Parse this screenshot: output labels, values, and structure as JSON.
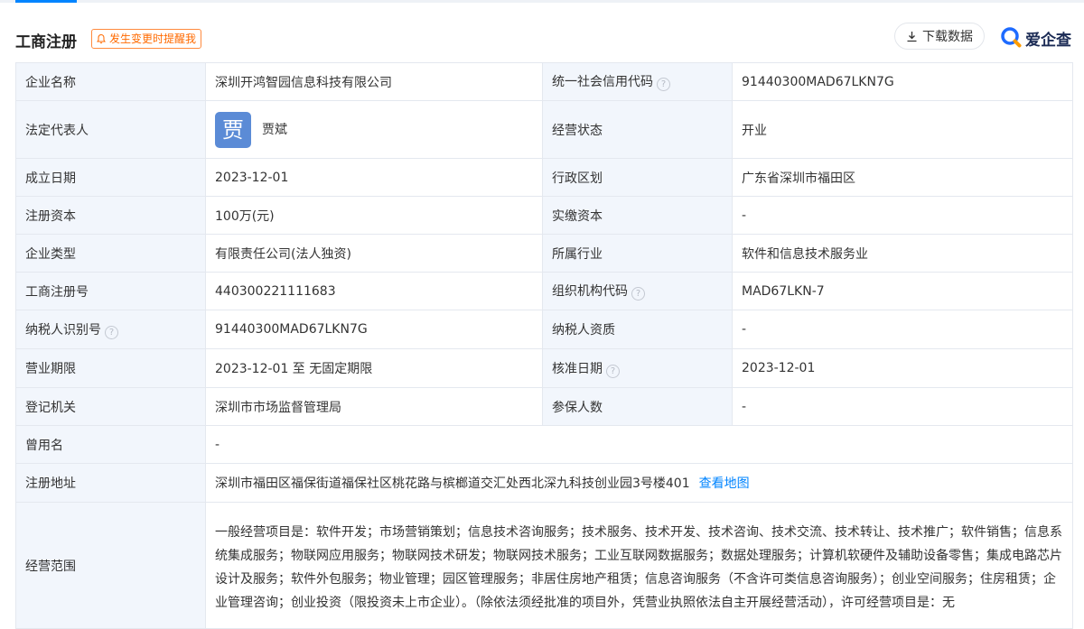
{
  "header": {
    "title": "工商注册",
    "remind_label": "发生变更时提醒我",
    "download_label": "下载数据",
    "brand_label": "爱企查"
  },
  "rows": [
    {
      "l1": "企业名称",
      "v1": "深圳开鸿智园信息科技有限公司",
      "l2": "统一社会信用代码",
      "v2": "91440300MAD67LKN7G"
    },
    {
      "l1": "法定代表人",
      "v1": "贾斌",
      "avatar": "贾",
      "l2": "经营状态",
      "v2": "开业"
    },
    {
      "l1": "成立日期",
      "v1": "2023-12-01",
      "l2": "行政区划",
      "v2": "广东省深圳市福田区"
    },
    {
      "l1": "注册资本",
      "v1": "100万(元)",
      "l2": "实缴资本",
      "v2": "-"
    },
    {
      "l1": "企业类型",
      "v1": "有限责任公司(法人独资)",
      "l2": "所属行业",
      "v2": "软件和信息技术服务业"
    },
    {
      "l1": "工商注册号",
      "v1": "440300221111683",
      "l2": "组织机构代码",
      "v2": "MAD67LKN-7"
    },
    {
      "l1": "纳税人识别号",
      "v1": "91440300MAD67LKN7G",
      "l2": "纳税人资质",
      "v2": "-"
    },
    {
      "l1": "营业期限",
      "v1": "2023-12-01 至 无固定期限",
      "l2": "核准日期",
      "v2": "2023-12-01"
    },
    {
      "l1": "登记机关",
      "v1": "深圳市市场监督管理局",
      "l2": "参保人数",
      "v2": "-"
    },
    {
      "l1": "曾用名",
      "v1": "-"
    },
    {
      "l1": "注册地址",
      "v1": "深圳市福田区福保街道福保社区桃花路与槟榔道交汇处西北深九科技创业园3号楼401",
      "link": "查看地图"
    },
    {
      "l1": "经营范围",
      "v1": "一般经营项目是：软件开发；市场营销策划；信息技术咨询服务；技术服务、技术开发、技术咨询、技术交流、技术转让、技术推广；软件销售；信息系统集成服务；物联网应用服务；物联网技术研发；物联网技术服务；工业互联网数据服务；数据处理服务；计算机软硬件及辅助设备零售；集成电路芯片设计及服务；软件外包服务；物业管理；园区管理服务；非居住房地产租赁；信息咨询服务（不含许可类信息咨询服务）；创业空间服务；住房租赁；企业管理咨询；创业投资（限投资未上市企业）。（除依法须经批准的项目外，凭营业执照依法自主开展经营活动），许可经营项目是：无"
    }
  ],
  "help_glyph": "?",
  "colors": {
    "accent": "#0084ff",
    "label_bg": "#f2f6fc",
    "remind": "#ff6a00",
    "avatar_bg": "#5b8bd6"
  }
}
